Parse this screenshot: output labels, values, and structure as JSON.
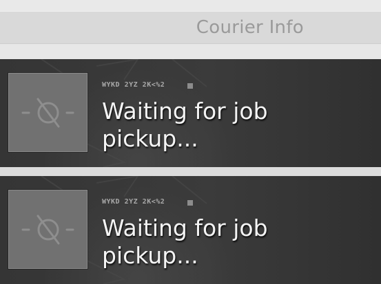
{
  "header": {
    "title": "Courier Info"
  },
  "couriers": [
    {
      "code": "WYKD 2YZ 2K<%2",
      "status": "Waiting for job pickup..."
    },
    {
      "code": "WYKD 2YZ 2K<%2",
      "status": "Waiting for job pickup..."
    }
  ],
  "colors": {
    "header_bg": "#d9d9d9",
    "header_text": "#9a9a9a",
    "card_bg": "#383838",
    "avatar_bg": "#717171",
    "status_text": "#f4f4f4"
  },
  "icons": {
    "avatar_placeholder": "no-image-icon"
  }
}
